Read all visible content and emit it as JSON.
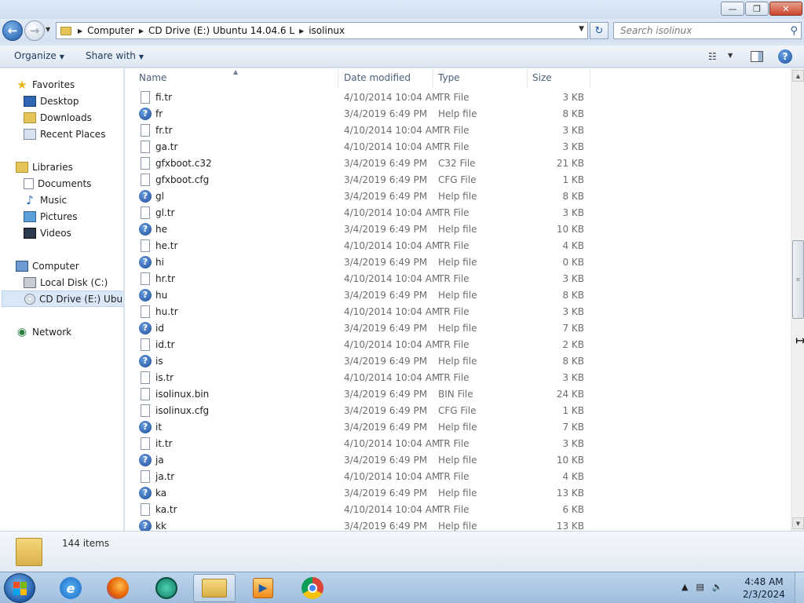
{
  "window": {
    "minimize_glyph": "—",
    "maximize_glyph": "❐",
    "close_glyph": "✕"
  },
  "address": {
    "breadcrumbs": [
      "Computer",
      "CD Drive (E:) Ubuntu 14.04.6 L",
      "isolinux"
    ],
    "search_placeholder": "Search isolinux"
  },
  "toolbar": {
    "organize_label": "Organize",
    "share_label": "Share with"
  },
  "nav": {
    "favorites": "Favorites",
    "desktop": "Desktop",
    "downloads": "Downloads",
    "recent": "Recent Places",
    "libraries": "Libraries",
    "documents": "Documents",
    "music": "Music",
    "pictures": "Pictures",
    "videos": "Videos",
    "computer": "Computer",
    "local_disk": "Local Disk (C:)",
    "cd_drive": "CD Drive (E:) Ubuntu",
    "network": "Network"
  },
  "columns": {
    "name": "Name",
    "date": "Date modified",
    "type": "Type",
    "size": "Size"
  },
  "files": [
    {
      "name": "fi.tr",
      "date": "4/10/2014 10:04 AM",
      "type": "TR File",
      "size": "3 KB",
      "icon": "file"
    },
    {
      "name": "fr",
      "date": "3/4/2019 6:49 PM",
      "type": "Help file",
      "size": "8 KB",
      "icon": "help"
    },
    {
      "name": "fr.tr",
      "date": "4/10/2014 10:04 AM",
      "type": "TR File",
      "size": "3 KB",
      "icon": "file"
    },
    {
      "name": "ga.tr",
      "date": "4/10/2014 10:04 AM",
      "type": "TR File",
      "size": "3 KB",
      "icon": "file"
    },
    {
      "name": "gfxboot.c32",
      "date": "3/4/2019 6:49 PM",
      "type": "C32 File",
      "size": "21 KB",
      "icon": "file"
    },
    {
      "name": "gfxboot.cfg",
      "date": "3/4/2019 6:49 PM",
      "type": "CFG File",
      "size": "1 KB",
      "icon": "file"
    },
    {
      "name": "gl",
      "date": "3/4/2019 6:49 PM",
      "type": "Help file",
      "size": "8 KB",
      "icon": "help"
    },
    {
      "name": "gl.tr",
      "date": "4/10/2014 10:04 AM",
      "type": "TR File",
      "size": "3 KB",
      "icon": "file"
    },
    {
      "name": "he",
      "date": "3/4/2019 6:49 PM",
      "type": "Help file",
      "size": "10 KB",
      "icon": "help"
    },
    {
      "name": "he.tr",
      "date": "4/10/2014 10:04 AM",
      "type": "TR File",
      "size": "4 KB",
      "icon": "file"
    },
    {
      "name": "hi",
      "date": "3/4/2019 6:49 PM",
      "type": "Help file",
      "size": "0 KB",
      "icon": "help"
    },
    {
      "name": "hr.tr",
      "date": "4/10/2014 10:04 AM",
      "type": "TR File",
      "size": "3 KB",
      "icon": "file"
    },
    {
      "name": "hu",
      "date": "3/4/2019 6:49 PM",
      "type": "Help file",
      "size": "8 KB",
      "icon": "help"
    },
    {
      "name": "hu.tr",
      "date": "4/10/2014 10:04 AM",
      "type": "TR File",
      "size": "3 KB",
      "icon": "file"
    },
    {
      "name": "id",
      "date": "3/4/2019 6:49 PM",
      "type": "Help file",
      "size": "7 KB",
      "icon": "help"
    },
    {
      "name": "id.tr",
      "date": "4/10/2014 10:04 AM",
      "type": "TR File",
      "size": "2 KB",
      "icon": "file"
    },
    {
      "name": "is",
      "date": "3/4/2019 6:49 PM",
      "type": "Help file",
      "size": "8 KB",
      "icon": "help"
    },
    {
      "name": "is.tr",
      "date": "4/10/2014 10:04 AM",
      "type": "TR File",
      "size": "3 KB",
      "icon": "file"
    },
    {
      "name": "isolinux.bin",
      "date": "3/4/2019 6:49 PM",
      "type": "BIN File",
      "size": "24 KB",
      "icon": "file"
    },
    {
      "name": "isolinux.cfg",
      "date": "3/4/2019 6:49 PM",
      "type": "CFG File",
      "size": "1 KB",
      "icon": "file"
    },
    {
      "name": "it",
      "date": "3/4/2019 6:49 PM",
      "type": "Help file",
      "size": "7 KB",
      "icon": "help"
    },
    {
      "name": "it.tr",
      "date": "4/10/2014 10:04 AM",
      "type": "TR File",
      "size": "3 KB",
      "icon": "file"
    },
    {
      "name": "ja",
      "date": "3/4/2019 6:49 PM",
      "type": "Help file",
      "size": "10 KB",
      "icon": "help"
    },
    {
      "name": "ja.tr",
      "date": "4/10/2014 10:04 AM",
      "type": "TR File",
      "size": "4 KB",
      "icon": "file"
    },
    {
      "name": "ka",
      "date": "3/4/2019 6:49 PM",
      "type": "Help file",
      "size": "13 KB",
      "icon": "help"
    },
    {
      "name": "ka.tr",
      "date": "4/10/2014 10:04 AM",
      "type": "TR File",
      "size": "6 KB",
      "icon": "file"
    },
    {
      "name": "kk",
      "date": "3/4/2019 6:49 PM",
      "type": "Help file",
      "size": "13 KB",
      "icon": "help"
    }
  ],
  "status": {
    "item_count": "144 items"
  },
  "taskbar": {
    "time": "4:48 AM",
    "date": "2/3/2024"
  },
  "colors": {
    "help_icon": "#1b4d98",
    "accent": "#1d5aa6",
    "selection": "#d9e7f7"
  }
}
